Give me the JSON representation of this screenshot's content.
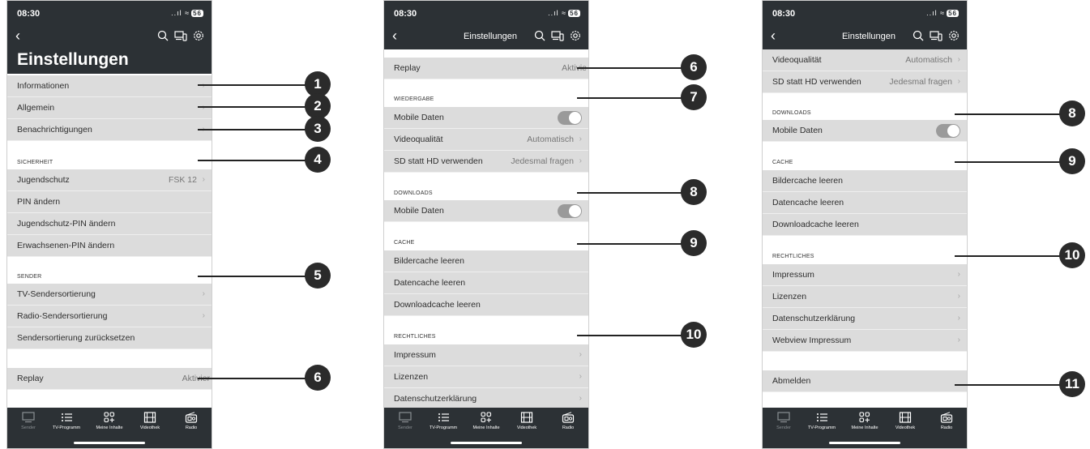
{
  "status": {
    "time": "08:30",
    "signal": "..ıl",
    "wifi": "≈",
    "battery": "56"
  },
  "screen1": {
    "title": "Einstellungen",
    "items": {
      "informationen": "Informationen",
      "allgemein": "Allgemein",
      "benachrichtigungen": "Benachrichtigungen"
    },
    "sicherheit": {
      "label": "SICHERHEIT",
      "jugendschutz": "Jugendschutz",
      "jugendschutz_value": "FSK 12",
      "pin": "PIN ändern",
      "jugendschutz_pin": "Jugendschutz-PIN ändern",
      "erwachsenen_pin": "Erwachsenen-PIN ändern"
    },
    "sender": {
      "label": "SENDER",
      "tv": "TV-Sendersortierung",
      "radio": "Radio-Sendersortierung",
      "reset": "Sendersortierung zurücksetzen"
    },
    "replay": "Replay",
    "replay_value": "Aktivier"
  },
  "screen2": {
    "nav_title": "Einstellungen",
    "replay": "Replay",
    "replay_value": "Aktivie",
    "wiedergabe": {
      "label": "WIEDERGABE",
      "mobile_daten": "Mobile Daten",
      "videoqualitaet": "Videoqualität",
      "videoqualitaet_value": "Automatisch",
      "sd_hd": "SD statt HD verwenden",
      "sd_hd_value": "Jedesmal fragen"
    },
    "downloads": {
      "label": "DOWNLOADS",
      "mobile_daten": "Mobile Daten"
    },
    "cache": {
      "label": "CACHE",
      "bildercache": "Bildercache leeren",
      "datencache": "Datencache leeren",
      "downloadcache": "Downloadcache leeren"
    },
    "rechtliches": {
      "label": "RECHTLICHES",
      "impressum": "Impressum",
      "lizenzen": "Lizenzen",
      "datenschutz": "Datenschutzerklärung"
    }
  },
  "screen3": {
    "nav_title": "Einstellungen",
    "videoqualitaet": "Videoqualität",
    "videoqualitaet_value": "Automatisch",
    "sd_hd": "SD statt HD verwenden",
    "sd_hd_value": "Jedesmal fragen",
    "downloads": {
      "label": "DOWNLOADS",
      "mobile_daten": "Mobile Daten"
    },
    "cache": {
      "label": "CACHE",
      "bildercache": "Bildercache leeren",
      "datencache": "Datencache leeren",
      "downloadcache": "Downloadcache leeren"
    },
    "rechtliches": {
      "label": "RECHTLICHES",
      "impressum": "Impressum",
      "lizenzen": "Lizenzen",
      "datenschutz": "Datenschutzerklärung",
      "webview": "Webview Impressum"
    },
    "abmelden": "Abmelden"
  },
  "tabbar": {
    "sender": "Sender",
    "tv_programm": "TV-Programm",
    "meine_inhalte": "Meine Inhalte",
    "videothek": "Videothek",
    "radio": "Radio"
  },
  "callouts": {
    "c1": "1",
    "c2": "2",
    "c3": "3",
    "c4": "4",
    "c5": "5",
    "c6": "6",
    "c7": "7",
    "c8": "8",
    "c9": "9",
    "c10": "10",
    "c11": "11"
  },
  "colors": {
    "header": "#2c3135",
    "row": "#dcdcdc",
    "badge": "#2b2b2b",
    "toggle": "#9a9a9a"
  }
}
